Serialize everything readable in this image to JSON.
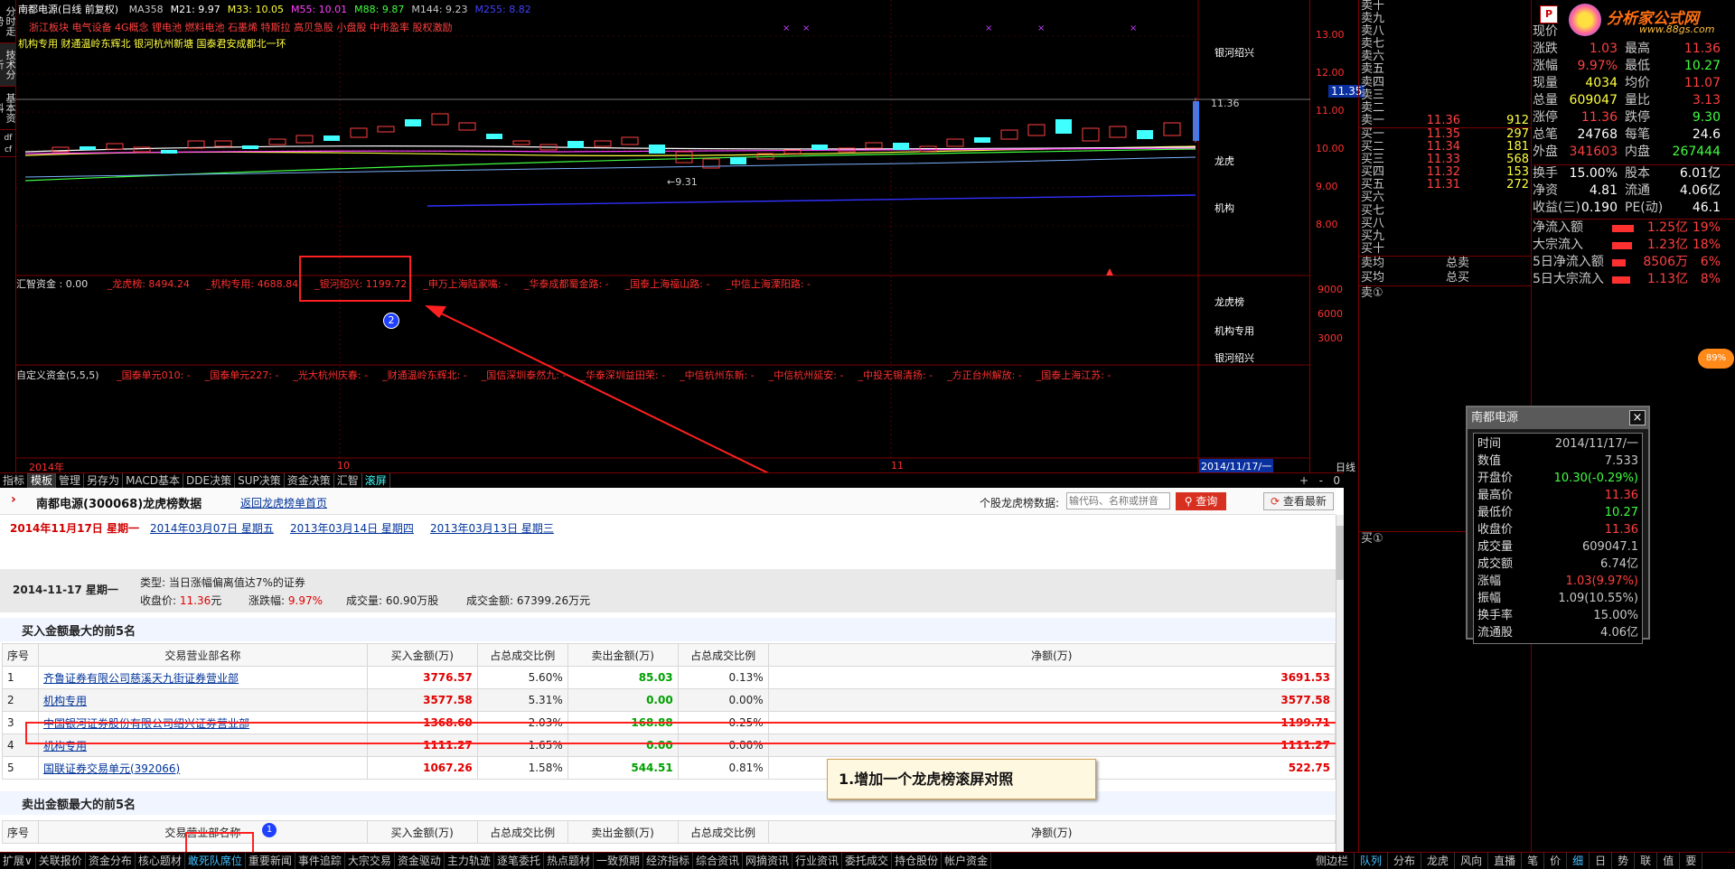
{
  "chart_top": {
    "title": "南都电源(日线 前复权)",
    "ma_labels": [
      {
        "t": "MA358",
        "c": "#c8c8c8"
      },
      {
        "t": "M21: 9.97",
        "c": "#ffffff"
      },
      {
        "t": "M33: 10.05",
        "c": "#ffff40"
      },
      {
        "t": "M55: 10.01",
        "c": "#ff40ff"
      },
      {
        "t": "M88: 9.87",
        "c": "#40ff40"
      },
      {
        "t": "M144: 9.23",
        "c": "#c8c8c8"
      },
      {
        "t": "M255: 8.82",
        "c": "#4040ff"
      }
    ],
    "concepts_line1": "浙江板块 电气设备 4G概念 锂电池 燃料电池 石墨烯 特斯拉 高贝急股 小盘股 中市盈率 股权激励",
    "concepts_line2": "机构专用 财通温岭东辉北 银河杭州新塘 国泰君安成都北一环",
    "price_axis": [
      "13.00",
      "12.00",
      "11.00",
      "10.00",
      "9.00",
      "8.00"
    ],
    "current_price_tag": "11.35",
    "high_label": "11.36",
    "low_label": "9.31",
    "right_labels": {
      "a": "银河绍兴",
      "b": "龙虎",
      "c": "机构"
    },
    "funds_row": {
      "label": "汇智资金 : 0.00",
      "items": [
        {
          "t": "_龙虎榜: 8494.24"
        },
        {
          "t": "_机构专用: 4688.84"
        },
        {
          "t": "_银河绍兴: 1199.72"
        },
        {
          "t": "_申万上海陆家嘴: -"
        },
        {
          "t": "_华泰成都蜀金路: -"
        },
        {
          "t": "_国泰上海福山路: -"
        },
        {
          "t": "_中信上海溧阳路: -"
        }
      ],
      "axis": [
        "9000",
        "6000",
        "3000"
      ],
      "right": [
        "龙虎榜",
        "机构专用",
        "银河绍兴"
      ]
    },
    "custom_row": {
      "label": "自定义资金(5,5,5)",
      "items": [
        "_国泰单元010: -",
        "_国泰单元227: -",
        "_光大杭州庆春: -",
        "_财通温岭东辉北: -",
        "_国信深圳泰然九: -",
        "_华泰深圳益田荣: -",
        "_中信杭州东新: -",
        "_中信杭州延安: -",
        "_中投无锡清扬: -",
        "_方正台州解放: -",
        "_国泰上海江苏: -"
      ]
    },
    "time_axis": [
      "2014年",
      "10",
      "11"
    ],
    "date_label": "2014/11/17/一",
    "period_label": "日线"
  },
  "left_tabs": [
    "分时走势",
    "技术分析",
    "基本资料",
    "df cf"
  ],
  "toolbar_tabs": [
    "指标",
    "模板",
    "管理",
    "另存为",
    "MACD基本",
    "DDE决策",
    "SUP决策",
    "资金决策",
    "汇智",
    "滚屏"
  ],
  "toolbar_right": [
    "+",
    "-",
    "0"
  ],
  "order_book": {
    "sells": [
      {
        "l": "卖十",
        "p": "",
        "v": ""
      },
      {
        "l": "卖九",
        "p": "",
        "v": ""
      },
      {
        "l": "卖八",
        "p": "",
        "v": ""
      },
      {
        "l": "卖七",
        "p": "",
        "v": ""
      },
      {
        "l": "卖六",
        "p": "",
        "v": ""
      },
      {
        "l": "卖五",
        "p": "",
        "v": ""
      },
      {
        "l": "卖四",
        "p": "",
        "v": ""
      },
      {
        "l": "卖三",
        "p": "",
        "v": ""
      },
      {
        "l": "卖二",
        "p": "",
        "v": ""
      },
      {
        "l": "卖一",
        "p": "11.36",
        "v": "912"
      }
    ],
    "buys": [
      {
        "l": "买一",
        "p": "11.35",
        "v": "297"
      },
      {
        "l": "买二",
        "p": "11.34",
        "v": "181"
      },
      {
        "l": "买三",
        "p": "11.33",
        "v": "568"
      },
      {
        "l": "买四",
        "p": "11.32",
        "v": "153"
      },
      {
        "l": "买五",
        "p": "11.31",
        "v": "272"
      },
      {
        "l": "买六",
        "p": "",
        "v": ""
      },
      {
        "l": "买七",
        "p": "",
        "v": ""
      },
      {
        "l": "买八",
        "p": "",
        "v": ""
      },
      {
        "l": "买九",
        "p": "",
        "v": ""
      },
      {
        "l": "买十",
        "p": "",
        "v": ""
      }
    ],
    "avg_sell": "卖均",
    "total_sell": "总卖",
    "avg_buy": "买均",
    "total_buy": "总买",
    "queue_sell": "卖①",
    "queue_buy": "买①"
  },
  "logo": {
    "text": "分析家公式网",
    "url": "www.88gs.com"
  },
  "quote": {
    "rows": [
      {
        "k": "现价",
        "v": "",
        "vc": "#ff4040",
        "k2": "",
        "v2": "",
        "v2c": "#ff4040"
      },
      {
        "k": "涨跌",
        "v": "1.03",
        "vc": "#ff4040",
        "k2": "最高",
        "v2": "11.36",
        "v2c": "#ff4040"
      },
      {
        "k": "涨幅",
        "v": "9.97%",
        "vc": "#ff4040",
        "k2": "最低",
        "v2": "10.27",
        "v2c": "#40ff40"
      },
      {
        "k": "现量",
        "v": "4034",
        "vc": "#ffff40",
        "k2": "均价",
        "v2": "11.07",
        "v2c": "#ff4040"
      },
      {
        "k": "总量",
        "v": "609047",
        "vc": "#ffff40",
        "k2": "量比",
        "v2": "3.13",
        "v2c": "#ff4040"
      },
      {
        "k": "涨停",
        "v": "11.36",
        "vc": "#ff4040",
        "k2": "跌停",
        "v2": "9.30",
        "v2c": "#40ff40"
      },
      {
        "k": "总笔",
        "v": "24768",
        "vc": "#ffffff",
        "k2": "每笔",
        "v2": "24.6",
        "v2c": "#ffffff"
      },
      {
        "k": "外盘",
        "v": "341603",
        "vc": "#ff4040",
        "k2": "内盘",
        "v2": "267444",
        "v2c": "#40ff40"
      }
    ],
    "rows2": [
      {
        "k": "换手",
        "v": "15.00%",
        "vc": "#ffffff",
        "k2": "股本",
        "v2": "6.01亿",
        "v2c": "#ffffff"
      },
      {
        "k": "净资",
        "v": "4.81",
        "vc": "#ffffff",
        "k2": "流通",
        "v2": "4.06亿",
        "v2c": "#ffffff"
      },
      {
        "k": "收益(三)",
        "v": "0.190",
        "vc": "#ffffff",
        "k2": "PE(动)",
        "v2": "46.1",
        "v2c": "#ffffff"
      }
    ],
    "flows": [
      {
        "k": "净流入额",
        "bar": 0.85,
        "v": "1.25亿",
        "p": "19%"
      },
      {
        "k": "大宗流入",
        "bar": 0.8,
        "v": "1.23亿",
        "p": "18%"
      },
      {
        "k": "5日净流入额",
        "bar": 0.55,
        "v": "8506万",
        "p": "6%"
      },
      {
        "k": "5日大宗流入",
        "bar": 0.72,
        "v": "1.13亿",
        "p": "8%"
      }
    ]
  },
  "info_window": {
    "title": "南都电源",
    "rows": [
      {
        "k": "时间",
        "v": "2014/11/17/一",
        "c": "#c8c8c8"
      },
      {
        "k": "数值",
        "v": "7.533",
        "c": "#c8c8c8"
      },
      {
        "k": "开盘价",
        "v": "10.30(-0.29%)",
        "c": "#40ff40"
      },
      {
        "k": "最高价",
        "v": "11.36",
        "c": "#ff4040"
      },
      {
        "k": "最低价",
        "v": "10.27",
        "c": "#40ff40"
      },
      {
        "k": "收盘价",
        "v": "11.36",
        "c": "#ff4040"
      },
      {
        "k": "成交量",
        "v": "609047.1",
        "c": "#c8c8c8"
      },
      {
        "k": "成交额",
        "v": "6.74亿",
        "c": "#c8c8c8"
      },
      {
        "k": "涨幅",
        "v": "1.03(9.97%)",
        "c": "#ff4040"
      },
      {
        "k": "振幅",
        "v": "1.09(10.55%)",
        "c": "#c8c8c8"
      },
      {
        "k": "换手率",
        "v": "15.00%",
        "c": "#c8c8c8"
      },
      {
        "k": "流通股",
        "v": "4.06亿",
        "c": "#c8c8c8"
      }
    ]
  },
  "web": {
    "title": "南都电源(300068)龙虎榜数据",
    "back_link": "返回龙虎榜单首页",
    "search_label": "个股龙虎榜数据:",
    "search_placeholder": "输代码、名称或拼音",
    "search_button": "查询",
    "latest_button": "查看最新",
    "dates": [
      "2014年11月17日  星期一",
      "2014年03月07日  星期五",
      "2013年03月14日  星期四",
      "2013年03月13日  星期三"
    ],
    "summary": {
      "date": "2014-11-17  星期一",
      "type_label": "类型:",
      "type_value": "当日涨幅偏离值达7%的证券",
      "close_label": "收盘价:",
      "close_value": "11.36",
      "close_unit": "元",
      "chg_label": "涨跌幅:",
      "chg_value": "9.97%",
      "vol_label": "成交量:",
      "vol_value": "60.90万股",
      "amt_label": "成交金额:",
      "amt_value": "67399.26万元"
    },
    "buy_title": "买入金额最大的前5名",
    "sell_title": "卖出金额最大的前5名",
    "headers": [
      "序号",
      "交易营业部名称",
      "买入金额(万)",
      "占总成交比例",
      "卖出金额(万)",
      "占总成交比例",
      "净额(万)"
    ],
    "buy_rows": [
      {
        "n": "1",
        "name": "齐鲁证券有限公司慈溪天九街证券营业部",
        "b": "3776.57",
        "bp": "5.60%",
        "s": "85.03",
        "sp": "0.13%",
        "net": "3691.53"
      },
      {
        "n": "2",
        "name": "机构专用",
        "b": "3577.58",
        "bp": "5.31%",
        "s": "0.00",
        "sp": "0.00%",
        "net": "3577.58"
      },
      {
        "n": "3",
        "name": "中国银河证券股份有限公司绍兴证券营业部",
        "b": "1368.60",
        "bp": "2.03%",
        "s": "168.88",
        "sp": "0.25%",
        "net": "1199.71"
      },
      {
        "n": "4",
        "name": "机构专用",
        "b": "1111.27",
        "bp": "1.65%",
        "s": "0.00",
        "sp": "0.00%",
        "net": "1111.27"
      },
      {
        "n": "5",
        "name": "国联证券交易单元(392066)",
        "b": "1067.26",
        "bp": "1.58%",
        "s": "544.51",
        "sp": "0.81%",
        "net": "522.75"
      }
    ],
    "annotation": "1.增加一个龙虎榜滚屏对照"
  },
  "bottom_tabs": [
    "扩展∨",
    "关联报价",
    "资金分布",
    "核心题材",
    "敢死队席位",
    "重要新闻",
    "事件追踪",
    "大宗交易",
    "资金驱动",
    "主力轨迹",
    "逐笔委托",
    "热点题材",
    "一致预期",
    "经济指标",
    "综合资讯",
    "网摘资讯",
    "行业资讯",
    "委托成交",
    "持仓股份",
    "帐户资金"
  ],
  "bottom_right": [
    "侧边栏",
    "队列",
    "分布",
    "龙虎",
    "风向",
    "直播",
    "笔",
    "价",
    "细",
    "日",
    "势",
    "联",
    "值",
    "要"
  ],
  "badges": {
    "one": "1",
    "two": "2",
    "pct": "89%"
  }
}
